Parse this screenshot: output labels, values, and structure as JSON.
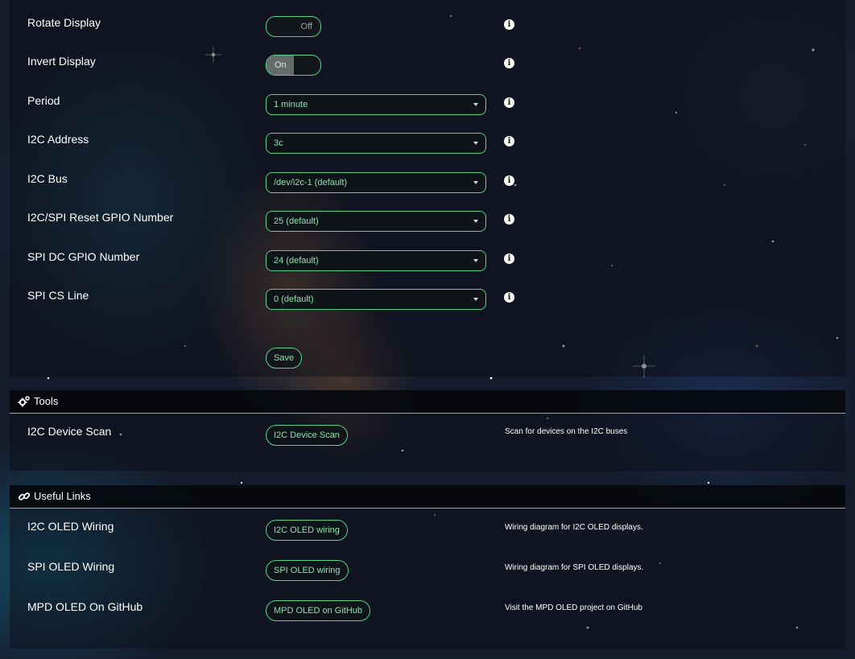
{
  "settings": {
    "rows": [
      {
        "label": "Rotate Display",
        "control": "toggle",
        "state": "off",
        "value": "Off"
      },
      {
        "label": "Invert Display",
        "control": "toggle",
        "state": "on",
        "value": "On"
      },
      {
        "label": "Period",
        "control": "select",
        "value": "1 minute"
      },
      {
        "label": "I2C Address",
        "control": "select",
        "value": "3c"
      },
      {
        "label": "I2C Bus",
        "control": "select",
        "value": "/dev/i2c-1 (default)"
      },
      {
        "label": "I2C/SPI Reset GPIO Number",
        "control": "select",
        "value": "25 (default)"
      },
      {
        "label": "SPI DC GPIO Number",
        "control": "select",
        "value": "24 (default)"
      },
      {
        "label": "SPI CS Line",
        "control": "select",
        "value": "0 (default)"
      }
    ],
    "info_icon": "info-circle-icon",
    "save_label": "Save"
  },
  "tools": {
    "title": "Tools",
    "icon": "gears-icon",
    "rows": [
      {
        "label": "I2C Device Scan",
        "button": "I2C Device Scan",
        "description": "Scan for devices on the I2C buses"
      }
    ]
  },
  "links": {
    "title": "Useful Links",
    "icon": "link-icon",
    "rows": [
      {
        "label": "I2C OLED Wiring",
        "button": "I2C OLED wiring",
        "description": "Wiring diagram for I2C OLED displays."
      },
      {
        "label": "SPI OLED Wiring",
        "button": "SPI OLED wiring",
        "description": "Wiring diagram for SPI OLED displays."
      },
      {
        "label": "MPD OLED On GitHub",
        "button": "MPD OLED on GitHub",
        "description": "Visit the MPD OLED project on GitHub"
      }
    ]
  },
  "colors": {
    "accent": "#5bd08c",
    "accent_text": "#8ee0ad",
    "panel_bg": "#0a0c14"
  }
}
